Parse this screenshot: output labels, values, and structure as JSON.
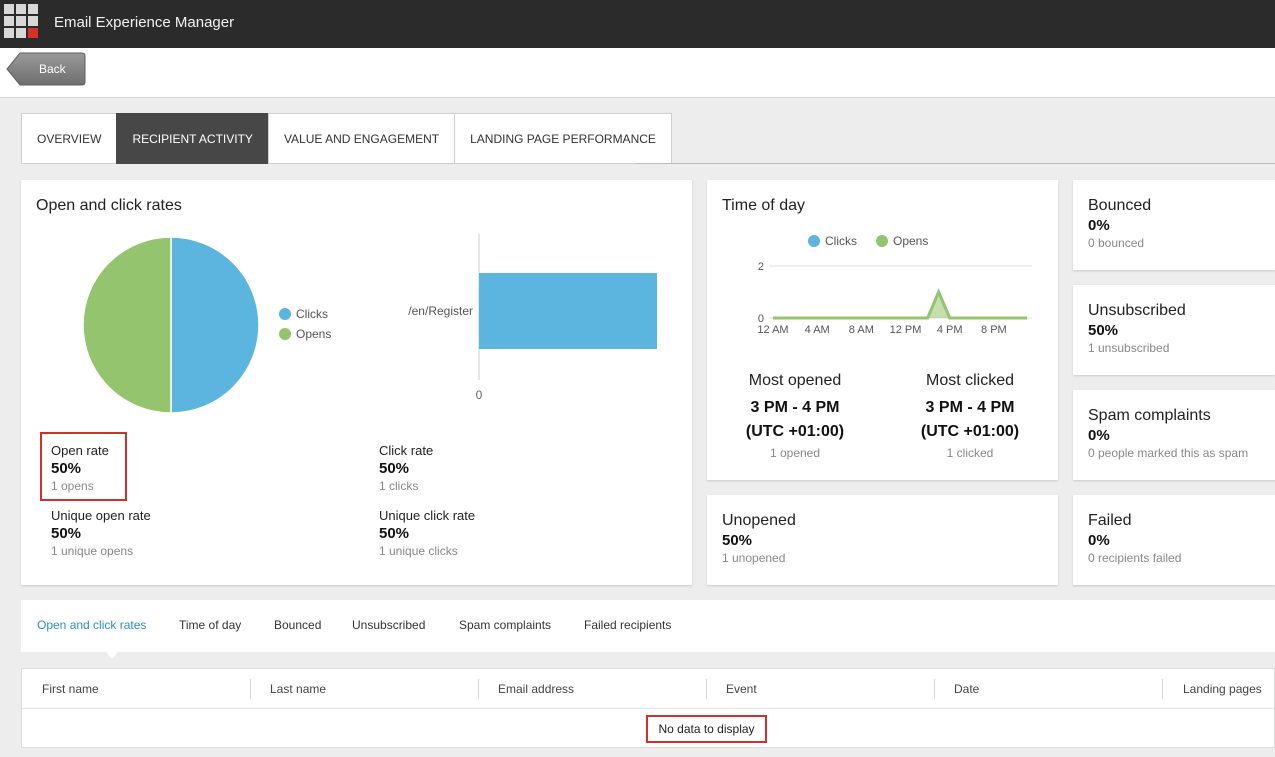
{
  "app": {
    "title": "Email Experience Manager",
    "logo_icon": "app-grid-icon"
  },
  "nav": {
    "back_label": "Back"
  },
  "tabs": [
    {
      "label": "OVERVIEW",
      "active": false
    },
    {
      "label": "RECIPIENT ACTIVITY",
      "active": true
    },
    {
      "label": "VALUE AND ENGAGEMENT",
      "active": false
    },
    {
      "label": "LANDING PAGE PERFORMANCE",
      "active": false
    }
  ],
  "colors": {
    "clicks": "#5bb5de",
    "opens": "#94c46d",
    "highlight": "#d0312d",
    "accent_link": "#2a8fc1"
  },
  "open_click": {
    "title": "Open and click rates",
    "legend": {
      "clicks": "Clicks",
      "opens": "Opens"
    },
    "bar_label": "/en/Register",
    "bar_axis_zero": "0",
    "stats": {
      "open_rate": {
        "label": "Open rate",
        "value": "50%",
        "sub": "1 opens"
      },
      "click_rate": {
        "label": "Click rate",
        "value": "50%",
        "sub": "1 clicks"
      },
      "unique_open_rate": {
        "label": "Unique open rate",
        "value": "50%",
        "sub": "1 unique opens"
      },
      "unique_click_rate": {
        "label": "Unique click rate",
        "value": "50%",
        "sub": "1 unique clicks"
      }
    }
  },
  "time_of_day": {
    "title": "Time of day",
    "legend": {
      "clicks": "Clicks",
      "opens": "Opens"
    },
    "y_ticks": [
      "2",
      "0"
    ],
    "x_ticks": [
      "12 AM",
      "4 AM",
      "8 AM",
      "12 PM",
      "4 PM",
      "8 PM"
    ],
    "most_opened": {
      "label": "Most opened",
      "line1": "3 PM - 4 PM",
      "line2": "(UTC +01:00)",
      "sub": "1 opened"
    },
    "most_clicked": {
      "label": "Most clicked",
      "line1": "3 PM - 4 PM",
      "line2": "(UTC +01:00)",
      "sub": "1 clicked"
    }
  },
  "chart_data": [
    {
      "type": "pie",
      "categories": [
        "Clicks",
        "Opens"
      ],
      "values": [
        1,
        1
      ]
    },
    {
      "type": "bar",
      "categories": [
        "/en/Register"
      ],
      "values": [
        1
      ],
      "orientation": "horizontal"
    },
    {
      "type": "line",
      "x": [
        "12 AM",
        "1 AM",
        "2 AM",
        "3 AM",
        "4 AM",
        "5 AM",
        "6 AM",
        "7 AM",
        "8 AM",
        "9 AM",
        "10 AM",
        "11 AM",
        "12 PM",
        "1 PM",
        "2 PM",
        "3 PM",
        "4 PM",
        "5 PM",
        "6 PM",
        "7 PM",
        "8 PM",
        "9 PM",
        "10 PM",
        "11 PM"
      ],
      "series": [
        {
          "name": "Clicks",
          "values": [
            0,
            0,
            0,
            0,
            0,
            0,
            0,
            0,
            0,
            0,
            0,
            0,
            0,
            0,
            0,
            1,
            0,
            0,
            0,
            0,
            0,
            0,
            0,
            0
          ]
        },
        {
          "name": "Opens",
          "values": [
            0,
            0,
            0,
            0,
            0,
            0,
            0,
            0,
            0,
            0,
            0,
            0,
            0,
            0,
            0,
            1,
            0,
            0,
            0,
            0,
            0,
            0,
            0,
            0
          ]
        }
      ],
      "ylim": [
        0,
        2
      ],
      "grid": true,
      "legend": "top"
    }
  ],
  "unopened": {
    "label": "Unopened",
    "value": "50%",
    "sub": "1 unopened"
  },
  "side_stats": {
    "bounced": {
      "label": "Bounced",
      "value": "0%",
      "sub": "0 bounced"
    },
    "unsubscribed": {
      "label": "Unsubscribed",
      "value": "50%",
      "sub": "1 unsubscribed"
    },
    "spam": {
      "label": "Spam complaints",
      "value": "0%",
      "sub": "0 people marked this as spam"
    },
    "failed": {
      "label": "Failed",
      "value": "0%",
      "sub": "0 recipients failed"
    }
  },
  "detail_tabs": [
    {
      "label": "Open and click rates",
      "active": true
    },
    {
      "label": "Time of day",
      "active": false
    },
    {
      "label": "Bounced",
      "active": false
    },
    {
      "label": "Unsubscribed",
      "active": false
    },
    {
      "label": "Spam complaints",
      "active": false
    },
    {
      "label": "Failed recipients",
      "active": false
    }
  ],
  "table": {
    "columns": [
      "First name",
      "Last name",
      "Email address",
      "Event",
      "Date",
      "Landing pages"
    ],
    "empty_message": "No data to display"
  }
}
